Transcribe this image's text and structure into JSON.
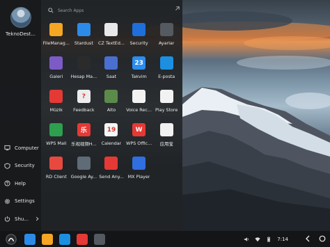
{
  "user": {
    "name": "TeknoDest..."
  },
  "search": {
    "placeholder": "Search Apps"
  },
  "apps": [
    {
      "label": "FileManag...",
      "icon": "folder-icon",
      "color": "#f5a623",
      "glyph": ""
    },
    {
      "label": "Stardust",
      "icon": "stardust-globe-icon",
      "color": "#2c8be8",
      "glyph": ""
    },
    {
      "label": "CZ TextEd...",
      "icon": "text-editor-icon",
      "color": "#e8e8e8",
      "glyph": ""
    },
    {
      "label": "Security",
      "icon": "shield-icon",
      "color": "#1e6fd9",
      "glyph": ""
    },
    {
      "label": "Ayarlar",
      "icon": "gear-icon",
      "color": "#555a60",
      "glyph": ""
    },
    {
      "label": "Galeri",
      "icon": "gallery-icon",
      "color": "#7d5bc6",
      "glyph": ""
    },
    {
      "label": "Hesap Ma...",
      "icon": "calculator-icon",
      "color": "#2b2b2b",
      "glyph": ""
    },
    {
      "label": "Saat",
      "icon": "clock-icon",
      "color": "#4a6fd0",
      "glyph": ""
    },
    {
      "label": "Takvim",
      "icon": "calendar-icon",
      "color": "#2a8df0",
      "glyph": "23"
    },
    {
      "label": "E-posta",
      "icon": "mail-icon",
      "color": "#1c8fe0",
      "glyph": ""
    },
    {
      "label": "Müzik",
      "icon": "music-icon",
      "color": "#e53935",
      "glyph": ""
    },
    {
      "label": "Feedback",
      "icon": "feedback-icon",
      "color": "#ececec",
      "glyph": "?"
    },
    {
      "label": "Alto",
      "icon": "alto-game-icon",
      "color": "#5b8a4a",
      "glyph": ""
    },
    {
      "label": "Voice Rec...",
      "icon": "voice-recorder-icon",
      "color": "#f2f2f2",
      "glyph": ""
    },
    {
      "label": "Play Store",
      "icon": "play-store-icon",
      "color": "#f2f2f2",
      "glyph": ""
    },
    {
      "label": "WPS Mail",
      "icon": "wps-mail-icon",
      "color": "#2e9e4f",
      "glyph": ""
    },
    {
      "label": "乐视视频H...",
      "icon": "letv-video-icon",
      "color": "#e53935",
      "glyph": "乐"
    },
    {
      "label": "Calendar",
      "icon": "calendar-19-icon",
      "color": "#f5f5f5",
      "glyph": "19"
    },
    {
      "label": "WPS Offic...",
      "icon": "wps-office-icon",
      "color": "#e53935",
      "glyph": "W"
    },
    {
      "label": "应用宝",
      "icon": "app-store-cn-icon",
      "color": "#f2f2f2",
      "glyph": ""
    },
    {
      "label": "RD Client",
      "icon": "remote-desktop-icon",
      "color": "#e8493f",
      "glyph": ""
    },
    {
      "label": "Google Ay...",
      "icon": "google-settings-icon",
      "color": "#5f6b77",
      "glyph": ""
    },
    {
      "label": "Send Any...",
      "icon": "send-anywhere-icon",
      "color": "#e53935",
      "glyph": ""
    },
    {
      "label": "MX Player",
      "icon": "mx-player-icon",
      "color": "#2f6fe0",
      "glyph": ""
    }
  ],
  "rail": [
    {
      "label": "Computer",
      "icon": "computer-icon"
    },
    {
      "label": "Security",
      "icon": "shield-outline-icon"
    },
    {
      "label": "Help",
      "icon": "help-icon"
    },
    {
      "label": "Settings",
      "icon": "settings-icon"
    },
    {
      "label": "Shu...",
      "icon": "power-icon"
    }
  ],
  "taskbar": {
    "apps": [
      {
        "icon": "stardust-globe-icon",
        "color": "#2c8be8"
      },
      {
        "icon": "folder-icon",
        "color": "#f5a623"
      },
      {
        "icon": "mail-icon",
        "color": "#1c8fe0"
      },
      {
        "icon": "wps-office-icon",
        "color": "#e53935"
      },
      {
        "icon": "gear-icon",
        "color": "#555a60"
      }
    ],
    "clock": "7:14"
  }
}
